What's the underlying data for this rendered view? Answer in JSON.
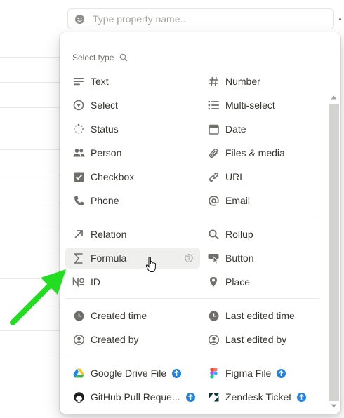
{
  "property_name": {
    "placeholder": "Type property name..."
  },
  "menu": {
    "header": "Select type",
    "groups": [
      {
        "left": [
          {
            "label": "Text",
            "icon": "text-lines-icon"
          },
          {
            "label": "Select",
            "icon": "select-circle-icon"
          },
          {
            "label": "Status",
            "icon": "status-spinner-icon"
          },
          {
            "label": "Person",
            "icon": "people-icon"
          },
          {
            "label": "Checkbox",
            "icon": "checkbox-icon"
          },
          {
            "label": "Phone",
            "icon": "phone-icon"
          }
        ],
        "right": [
          {
            "label": "Number",
            "icon": "hash-icon"
          },
          {
            "label": "Multi-select",
            "icon": "list-icon"
          },
          {
            "label": "Date",
            "icon": "calendar-icon"
          },
          {
            "label": "Files & media",
            "icon": "paperclip-icon"
          },
          {
            "label": "URL",
            "icon": "link-icon"
          },
          {
            "label": "Email",
            "icon": "at-icon"
          }
        ]
      },
      {
        "left": [
          {
            "label": "Relation",
            "icon": "arrow-up-right-icon"
          },
          {
            "label": "Formula",
            "icon": "sigma-icon",
            "hovered": true
          },
          {
            "label": "ID",
            "icon": "numero-icon"
          }
        ],
        "right": [
          {
            "label": "Rollup",
            "icon": "magnifier-icon"
          },
          {
            "label": "Button",
            "icon": "pointer-button-icon"
          },
          {
            "label": "Place",
            "icon": "pin-icon"
          }
        ]
      },
      {
        "left": [
          {
            "label": "Created time",
            "icon": "clock-icon"
          },
          {
            "label": "Created by",
            "icon": "user-circle-icon"
          }
        ],
        "right": [
          {
            "label": "Last edited time",
            "icon": "clock-icon"
          },
          {
            "label": "Last edited by",
            "icon": "user-circle-icon"
          }
        ]
      },
      {
        "left": [
          {
            "label": "Google Drive File",
            "icon": "google-drive-icon",
            "upgrade": true
          },
          {
            "label": "GitHub Pull Reque...",
            "icon": "github-icon",
            "upgrade": true
          }
        ],
        "right": [
          {
            "label": "Figma File",
            "icon": "figma-icon",
            "upgrade": true
          },
          {
            "label": "Zendesk Ticket",
            "icon": "zendesk-icon",
            "upgrade": true
          }
        ]
      }
    ]
  },
  "colors": {
    "text": "#37352f",
    "icon": "#6f6e69",
    "hover": "#efefed",
    "upgrade_badge": "#2383e2",
    "annotation_arrow": "#22dd22"
  }
}
